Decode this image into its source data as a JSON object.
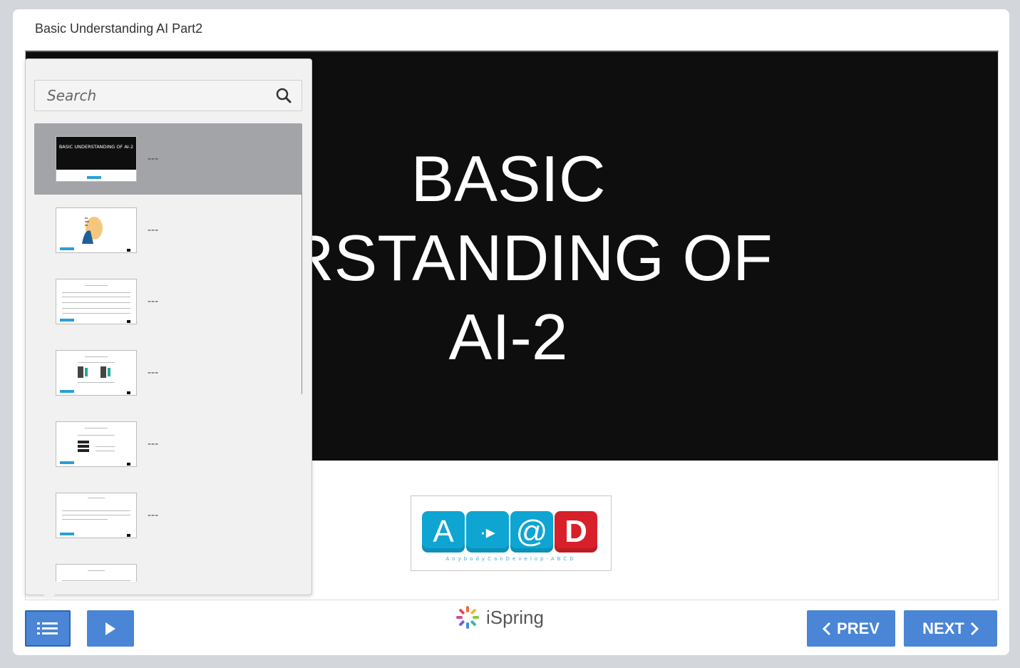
{
  "window": {
    "title": "Basic Understanding AI Part2"
  },
  "slide": {
    "title_lines": [
      "BASIC",
      "ERSTANDING OF",
      "AI-2"
    ],
    "logo": {
      "tiles": [
        "A",
        "·▸",
        "@",
        "D"
      ],
      "tagline": "AnybodyCanDevelop-ABCD"
    }
  },
  "outline": {
    "search": {
      "placeholder": "Search"
    },
    "items": [
      {
        "label": "---",
        "thumb_text": "BASIC UNDERSTANDING OF AI-2",
        "selected": true
      },
      {
        "label": "---",
        "selected": false
      },
      {
        "label": "---",
        "selected": false
      },
      {
        "label": "---",
        "selected": false
      },
      {
        "label": "---",
        "selected": false
      },
      {
        "label": "---",
        "selected": false
      },
      {
        "label": "",
        "selected": false
      }
    ]
  },
  "controls": {
    "prev_label": "PREV",
    "next_label": "NEXT",
    "brand": "iSpring",
    "accent_color": "#4a85d6"
  }
}
